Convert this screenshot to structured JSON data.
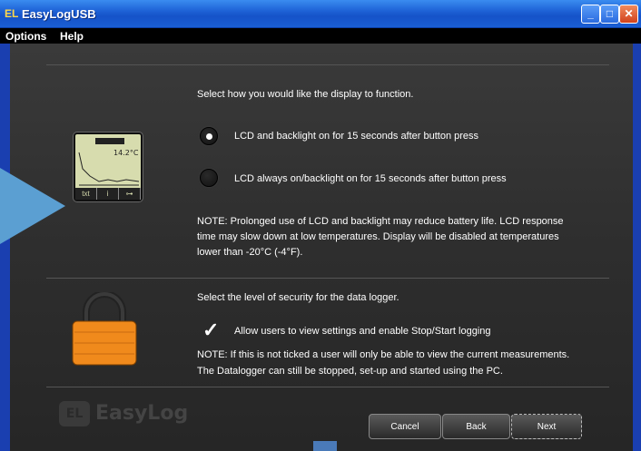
{
  "window": {
    "title": "EasyLogUSB",
    "app_icon": "EL"
  },
  "menu": {
    "items": [
      "Options",
      "Help"
    ]
  },
  "display": {
    "heading": "Select how you would like the display to function.",
    "options": [
      {
        "label": "LCD and backlight on for 15 seconds after button press",
        "selected": true
      },
      {
        "label": "LCD always on/backlight on for 15 seconds after button press",
        "selected": false
      }
    ],
    "note_lines": [
      "NOTE: Prolonged use of LCD and backlight may reduce battery life. LCD response",
      "time may slow down at low temperatures. Display will be disabled at temperatures",
      "lower than -20°C (-4°F)."
    ],
    "lcd": {
      "temp": "14.2°C",
      "keys": [
        "txt",
        "i",
        "⊶"
      ]
    }
  },
  "security": {
    "heading": "Select the level of security for the data logger.",
    "checkbox_label": "Allow users to view settings and enable Stop/Start logging",
    "checked": true,
    "note_lines": [
      "NOTE: If this is not ticked a user will only be able to view the current measurements.",
      "The Datalogger can still be stopped, set-up and started using the PC."
    ]
  },
  "logo": {
    "text": "EasyLog",
    "mark": "EL"
  },
  "buttons": {
    "cancel": "Cancel",
    "back": "Back",
    "next": "Next"
  }
}
